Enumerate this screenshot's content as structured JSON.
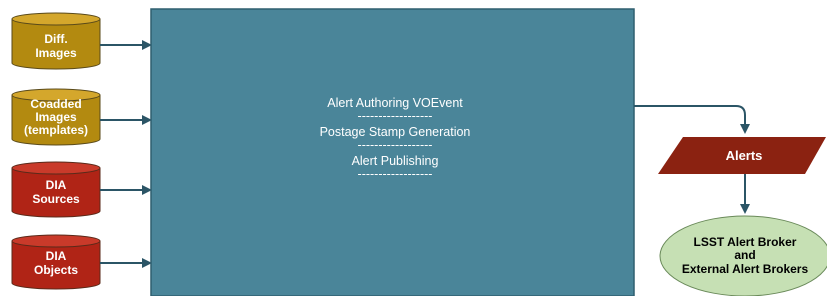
{
  "inputs": [
    {
      "lines": [
        "Diff.",
        "Images"
      ],
      "kind": "image-store"
    },
    {
      "lines": [
        "Coadded",
        "Images",
        "(templates)"
      ],
      "kind": "image-store"
    },
    {
      "lines": [
        "DIA",
        "Sources"
      ],
      "kind": "catalog-store"
    },
    {
      "lines": [
        "DIA",
        "Objects"
      ],
      "kind": "catalog-store"
    }
  ],
  "process": {
    "lines": [
      "Alert Authoring VOEvent",
      "------------------",
      "Postage Stamp Generation",
      "------------------",
      "Alert Publishing",
      "------------------"
    ]
  },
  "alerts": {
    "label": "Alerts"
  },
  "brokers": {
    "lines": [
      "LSST Alert Broker",
      "and",
      "External Alert Brokers"
    ]
  },
  "colors": {
    "image_store_fill": "#b38a10",
    "image_store_top": "#d4a72c",
    "catalog_store_fill": "#b02416",
    "catalog_store_top": "#c93a2a",
    "store_outline": "#5a4a1a",
    "process_fill": "#4a8599",
    "process_border": "#2e5f6f",
    "alerts_fill": "#8b2211",
    "brokers_fill": "#c6e0b4",
    "brokers_border": "#6a8a5a",
    "arrow": "#2b5566"
  }
}
